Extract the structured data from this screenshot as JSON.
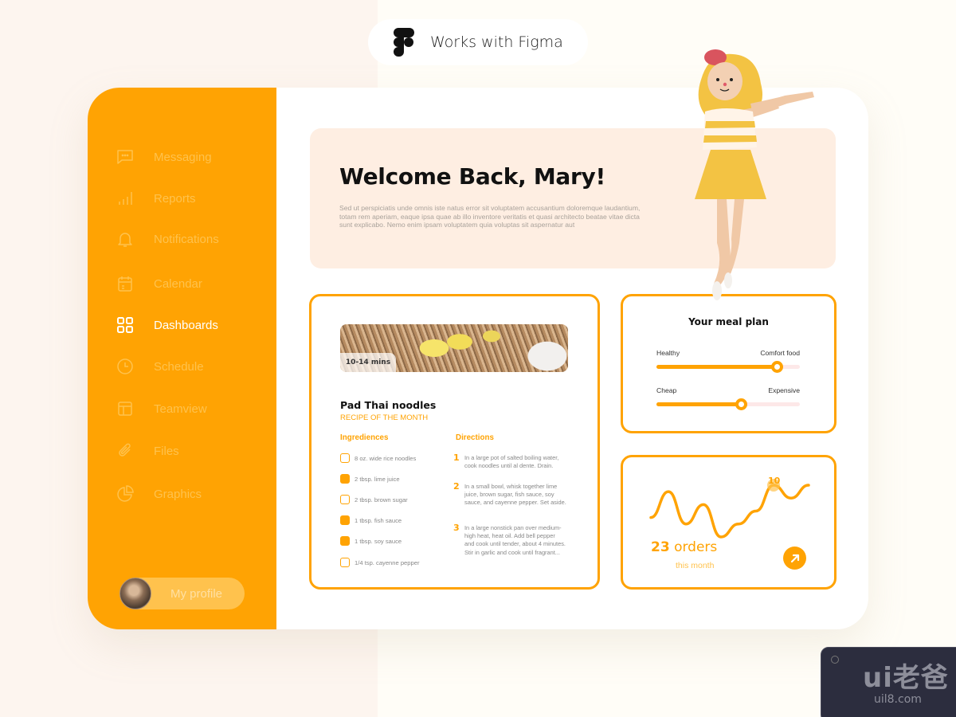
{
  "badge": {
    "text": "Works with Figma",
    "icon": "figma-logo-icon"
  },
  "colors": {
    "accent": "#ffa303",
    "accent_light": "#ffc24d",
    "banner_bg": "#feeee2",
    "track_bg": "#fde8e8"
  },
  "sidebar": {
    "items": [
      {
        "label": "Messaging",
        "icon": "chat-bubble-icon",
        "active": false
      },
      {
        "label": "Reports",
        "icon": "bar-chart-icon",
        "active": false
      },
      {
        "label": "Notifications",
        "icon": "bell-icon",
        "active": false
      },
      {
        "label": "Calendar",
        "icon": "calendar-icon",
        "active": false
      },
      {
        "label": "Dashboards",
        "icon": "grid-icon",
        "active": true
      },
      {
        "label": "Schedule",
        "icon": "clock-icon",
        "active": false
      },
      {
        "label": "Teamview",
        "icon": "layout-icon",
        "active": false
      },
      {
        "label": "Files",
        "icon": "paperclip-icon",
        "active": false
      },
      {
        "label": "Graphics",
        "icon": "pie-chart-icon",
        "active": false
      }
    ],
    "profile": {
      "label": "My profile"
    }
  },
  "welcome": {
    "title": "Welcome Back, Mary!",
    "body": "Sed ut perspiciatis unde omnis iste natus error sit voluptatem accusantium doloremque laudantium, totam rem aperiam, eaque ipsa quae ab illo inventore veritatis et quasi architecto beatae vitae dicta sunt explicabo. Nemo enim ipsam voluptatem quia voluptas sit aspernatur aut"
  },
  "recipe": {
    "time": "10-14 mins",
    "title": "Pad Thai noodles",
    "subtitle": "RECIPE OF THE MONTH",
    "ingredients_heading": "Ingrediences",
    "directions_heading": "Directions",
    "ingredients": [
      {
        "text": "8 oz. wide rice noodles",
        "checked": false
      },
      {
        "text": "2 tbsp. lime juice",
        "checked": true
      },
      {
        "text": "2 tbsp. brown sugar",
        "checked": false
      },
      {
        "text": "1 tbsp. fish sauce",
        "checked": true
      },
      {
        "text": "1 tbsp. soy sauce",
        "checked": true
      },
      {
        "text": "1/4 tsp. cayenne pepper",
        "checked": false
      }
    ],
    "directions": [
      {
        "n": "1",
        "text": "In a large pot of salted boiling water, cook noodles until al dente. Drain."
      },
      {
        "n": "2",
        "text": "In a small bowl, whisk together lime juice, brown sugar, fish sauce, soy sauce, and cayenne pepper. Set aside."
      },
      {
        "n": "3",
        "text": "In a large nonstick pan over medium-high heat, heat oil. Add bell pepper and cook until tender, about 4 minutes. Stir in garlic and cook until fragrant..."
      }
    ]
  },
  "meal_plan": {
    "title": "Your meal plan",
    "sliders": [
      {
        "left": "Healthy",
        "right": "Comfort food",
        "value_pct": 84
      },
      {
        "left": "Cheap",
        "right": "Expensive",
        "value_pct": 59
      }
    ]
  },
  "orders": {
    "count": "23",
    "unit": "orders",
    "period": "this month",
    "peak_label": "10",
    "arrow_icon": "arrow-up-right-icon",
    "trend": [
      5,
      9,
      4,
      7,
      2,
      4,
      6,
      10,
      8,
      10
    ]
  },
  "watermark": {
    "big": "ui老爸",
    "small": "uil8.com"
  }
}
